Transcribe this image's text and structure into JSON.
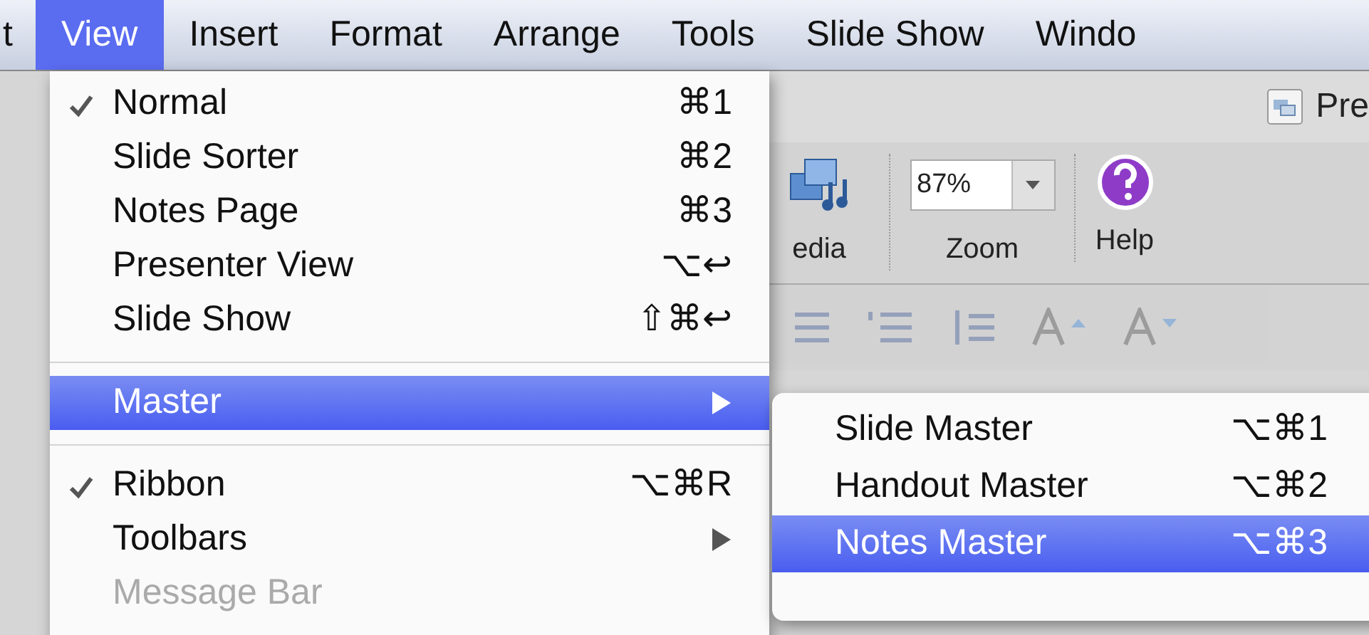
{
  "menubar": {
    "items": [
      {
        "label": "t",
        "selected": false
      },
      {
        "label": "View",
        "selected": true
      },
      {
        "label": "Insert",
        "selected": false
      },
      {
        "label": "Format",
        "selected": false
      },
      {
        "label": "Arrange",
        "selected": false
      },
      {
        "label": "Tools",
        "selected": false
      },
      {
        "label": "Slide Show",
        "selected": false
      },
      {
        "label": "Windo",
        "selected": false
      }
    ]
  },
  "window_title": "Pre",
  "ribbon": {
    "media_label": "edia",
    "zoom_value": "87%",
    "zoom_label": "Zoom",
    "help_label": "Help"
  },
  "view_menu": {
    "items": [
      {
        "kind": "item",
        "label": "Normal",
        "shortcut": "⌘1",
        "checked": true,
        "selected": false,
        "disabled": false
      },
      {
        "kind": "item",
        "label": "Slide Sorter",
        "shortcut": "⌘2",
        "checked": false,
        "selected": false,
        "disabled": false
      },
      {
        "kind": "item",
        "label": "Notes Page",
        "shortcut": "⌘3",
        "checked": false,
        "selected": false,
        "disabled": false
      },
      {
        "kind": "item",
        "label": "Presenter View",
        "shortcut": "⌥↩",
        "checked": false,
        "selected": false,
        "disabled": false
      },
      {
        "kind": "item",
        "label": "Slide Show",
        "shortcut": "⇧⌘↩",
        "checked": false,
        "selected": false,
        "disabled": false
      },
      {
        "kind": "separator"
      },
      {
        "kind": "submenu",
        "label": "Master",
        "checked": false,
        "selected": true,
        "disabled": false
      },
      {
        "kind": "separator"
      },
      {
        "kind": "item",
        "label": "Ribbon",
        "shortcut": "⌥⌘R",
        "checked": true,
        "selected": false,
        "disabled": false
      },
      {
        "kind": "submenu",
        "label": "Toolbars",
        "checked": false,
        "selected": false,
        "disabled": false
      },
      {
        "kind": "item",
        "label": "Message Bar",
        "checked": false,
        "selected": false,
        "disabled": true
      }
    ]
  },
  "master_submenu": {
    "items": [
      {
        "label": "Slide Master",
        "shortcut": "⌥⌘1",
        "selected": false
      },
      {
        "label": "Handout Master",
        "shortcut": "⌥⌘2",
        "selected": false
      },
      {
        "label": "Notes Master",
        "shortcut": "⌥⌘3",
        "selected": true
      }
    ]
  }
}
